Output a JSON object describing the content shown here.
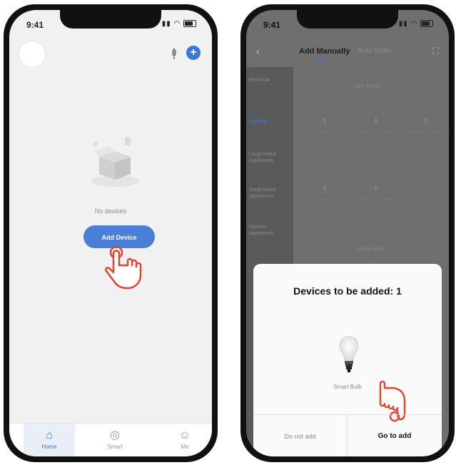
{
  "phone1": {
    "status": {
      "time": "9:41",
      "signal_icon": "signal-icon",
      "wifi_icon": "wifi-icon",
      "battery_icon": "battery-icon"
    },
    "header": {
      "avatar_icon": "avatar-icon",
      "voice_icon": "microphone-icon",
      "add_icon": "plus-circle-icon",
      "accent": "#3a78d8"
    },
    "empty_state": {
      "text": "No devices",
      "illustration_icon": "empty-box-icon"
    },
    "add_device_button": {
      "label": "Add Device",
      "color": "#4b7ed6"
    },
    "tabbar": [
      {
        "label": "Home",
        "icon": "home-icon",
        "active": true
      },
      {
        "label": "Smart",
        "icon": "smart-icon",
        "active": false
      },
      {
        "label": "Me",
        "icon": "profile-icon",
        "active": false
      }
    ]
  },
  "phone2": {
    "status": {
      "time": "9:41"
    },
    "nav": {
      "back_icon": "chevron-left-icon",
      "tab_manual": "Add Manually",
      "tab_auto": "Auto Scan",
      "scan_icon": "scan-icon"
    },
    "sidebar": [
      {
        "label": "Electrical",
        "active": false
      },
      {
        "label": "Lighting",
        "active": true
      },
      {
        "label": "Large Home Appliances",
        "active": false
      },
      {
        "label": "Small Home Appliances",
        "active": false
      },
      {
        "label": "Kitchen Appliances",
        "active": false
      }
    ],
    "category_title": "Light Source",
    "devices": [
      {
        "label": "Light Source (BLE+Wi-Fi)"
      },
      {
        "label": "Light Source (Wi-Fi)"
      },
      {
        "label": "Light Source (Zigbee)"
      },
      {
        "label": "Light Source (BLE)"
      },
      {
        "label": "Light Source (other)"
      }
    ],
    "subcategory_title": "Deco Lights",
    "sheet": {
      "title": "Devices to be added: 1",
      "device_label": "Smart Bulb",
      "device_icon": "bulb-icon",
      "btn_not_add": "Do not add",
      "btn_go_add": "Go to add"
    }
  },
  "gesture": {
    "hand_icon": "tap-hand-icon",
    "color": "#e0452f"
  }
}
